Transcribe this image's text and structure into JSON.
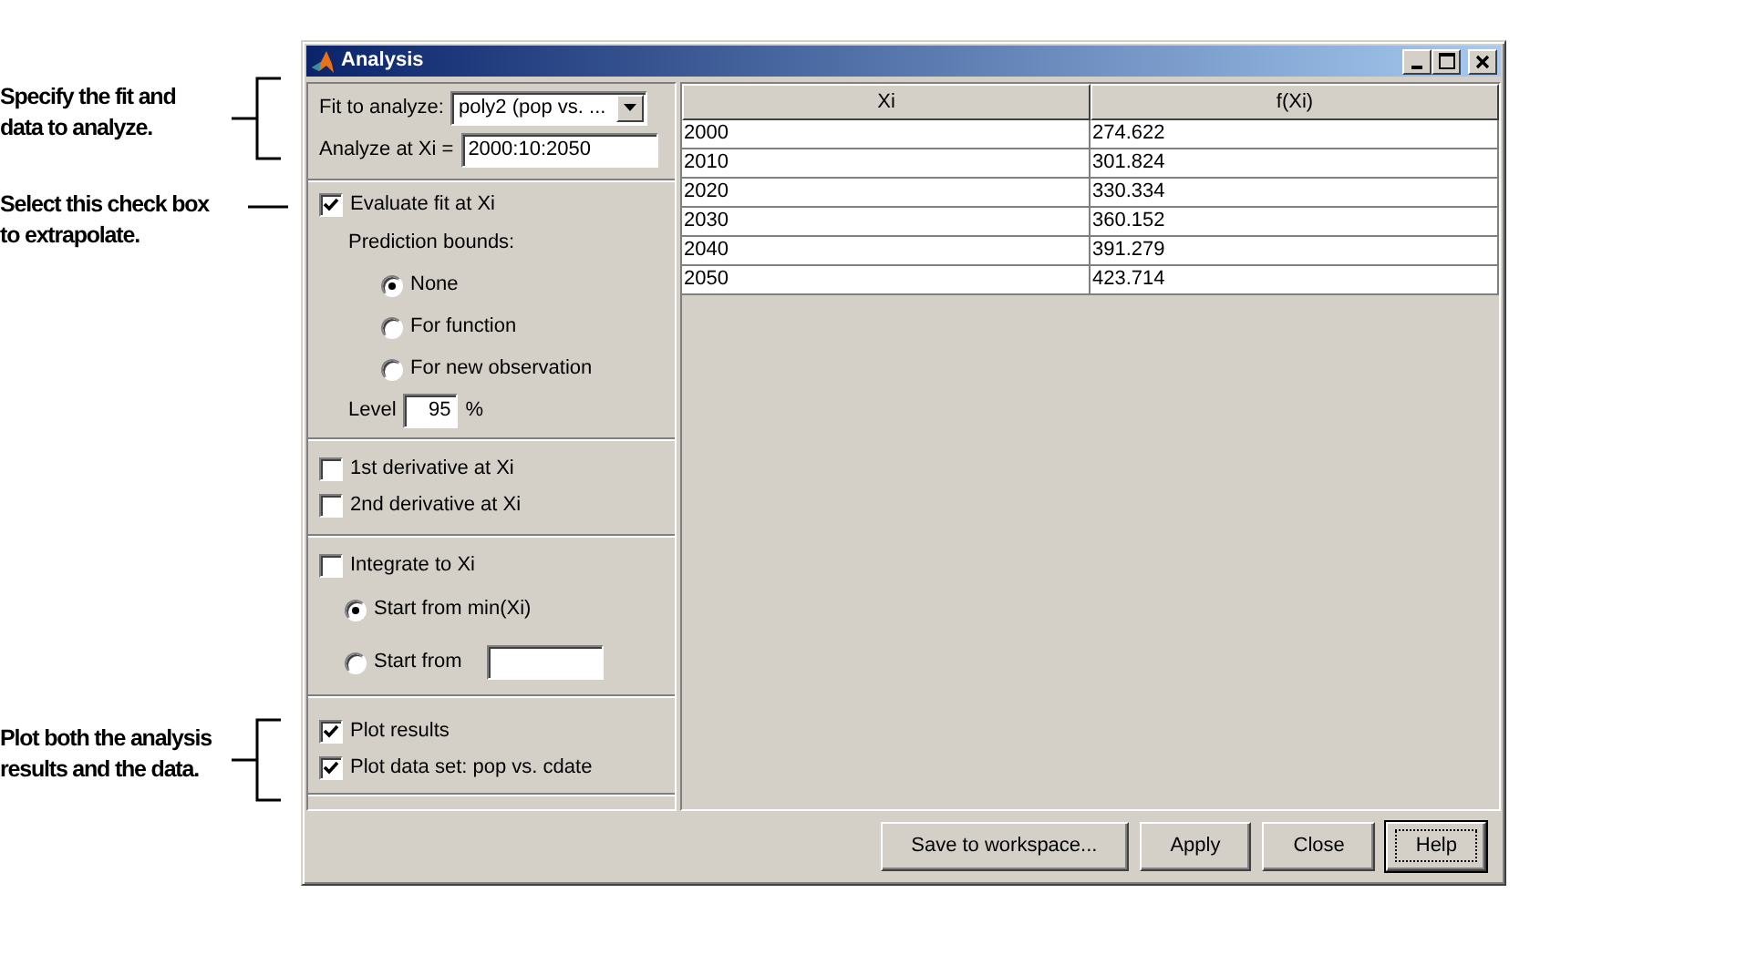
{
  "callouts": [
    {
      "lines": [
        "Specify the fit and",
        "data to analyze."
      ],
      "kind": "bracket"
    },
    {
      "lines": [
        "Select this check box",
        "to extrapolate."
      ],
      "kind": "line"
    },
    {
      "lines": [
        "Plot both the analysis",
        "results and the data."
      ],
      "kind": "bracket"
    }
  ],
  "window": {
    "title": "Analysis"
  },
  "fit_to_analyze": {
    "label": "Fit to analyze:",
    "value": "poly2 (pop vs. ..."
  },
  "analyze_at": {
    "label": "Analyze at Xi =",
    "value": "2000:10:2050"
  },
  "evaluate": {
    "label": "Evaluate fit at Xi",
    "checked": true
  },
  "prediction_bounds": {
    "label": "Prediction bounds:",
    "options": [
      {
        "label": "None",
        "selected": true
      },
      {
        "label": "For function",
        "selected": false
      },
      {
        "label": "For new observation",
        "selected": false
      }
    ]
  },
  "level": {
    "label": "Level",
    "value": "95",
    "unit": "%"
  },
  "derivatives": [
    {
      "label": "1st derivative at Xi",
      "checked": false
    },
    {
      "label": "2nd derivative at Xi",
      "checked": false
    }
  ],
  "integrate": {
    "label": "Integrate to Xi",
    "checked": false,
    "options": [
      {
        "label": "Start from min(Xi)",
        "selected": true,
        "kind": "plain"
      },
      {
        "label": "Start from",
        "selected": false,
        "kind": "field"
      }
    ]
  },
  "plots": [
    {
      "label": "Plot results",
      "checked": true
    },
    {
      "label": "Plot data set: pop vs. cdate",
      "checked": true
    }
  ],
  "table": {
    "columns": [
      "Xi",
      "f(Xi)"
    ],
    "rows": [
      [
        "2000",
        "274.622"
      ],
      [
        "2010",
        "301.824"
      ],
      [
        "2020",
        "330.334"
      ],
      [
        "2030",
        "360.152"
      ],
      [
        "2040",
        "391.279"
      ],
      [
        "2050",
        "423.714"
      ]
    ]
  },
  "buttons": [
    {
      "label": "Save to workspace...",
      "default": false
    },
    {
      "label": "Apply",
      "default": false
    },
    {
      "label": "Close",
      "default": false
    },
    {
      "label": "Help",
      "default": true
    }
  ]
}
